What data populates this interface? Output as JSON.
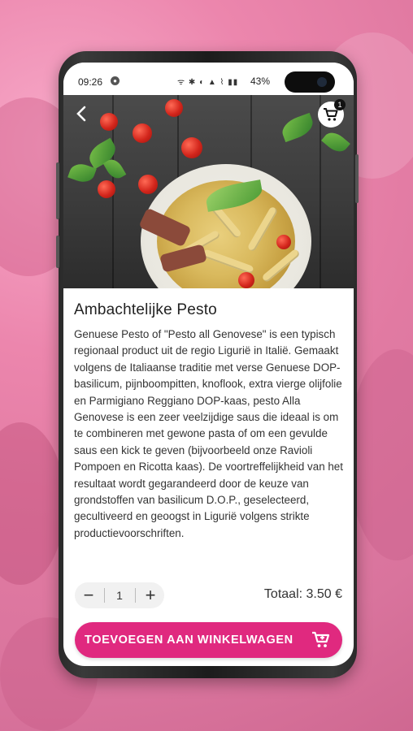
{
  "statusbar": {
    "time": "09:26",
    "notification_icon": "app-notification-icon",
    "system_icons": "ᯤ ✱ ◐ ▲ ⌇ ▮▮",
    "battery": "43%"
  },
  "product": {
    "title": "Ambachtelijke Pesto",
    "description": "Genuese Pesto of \"Pesto all Genovese\" is een typisch regionaal product uit de regio Ligurië in Italië. Gemaakt volgens de Italiaanse traditie met verse Genuese DOP-basilicum, pijnboompitten, knoflook, extra vierge olijfolie en Parmigiano Reggiano DOP-kaas, pesto Alla Genovese is een zeer veelzijdige saus die ideaal is om te combineren met gewone pasta of om een gevulde saus een kick te geven (bijvoorbeeld onze Ravioli Pompoen en Ricotta kaas). De voortreffelijkheid van het resultaat wordt gegarandeerd door de keuze van grondstoffen van basilicum D.O.P., geselecteerd, gecultiveerd en geoogst in Ligurië volgens strikte productievoorschriften."
  },
  "header": {
    "back_icon": "back-arrow-icon",
    "cart_icon": "shopping-cart-icon",
    "cart_count": "1"
  },
  "quantity": {
    "minus": "−",
    "value": "1",
    "plus": "+"
  },
  "total": "Totaal: 3.50 €",
  "add_button": {
    "label": "TOEVOEGEN AAN WINKELWAGEN",
    "icon": "add-to-cart-icon"
  },
  "colors": {
    "accent": "#e0297f",
    "background": "#e17aa2"
  }
}
